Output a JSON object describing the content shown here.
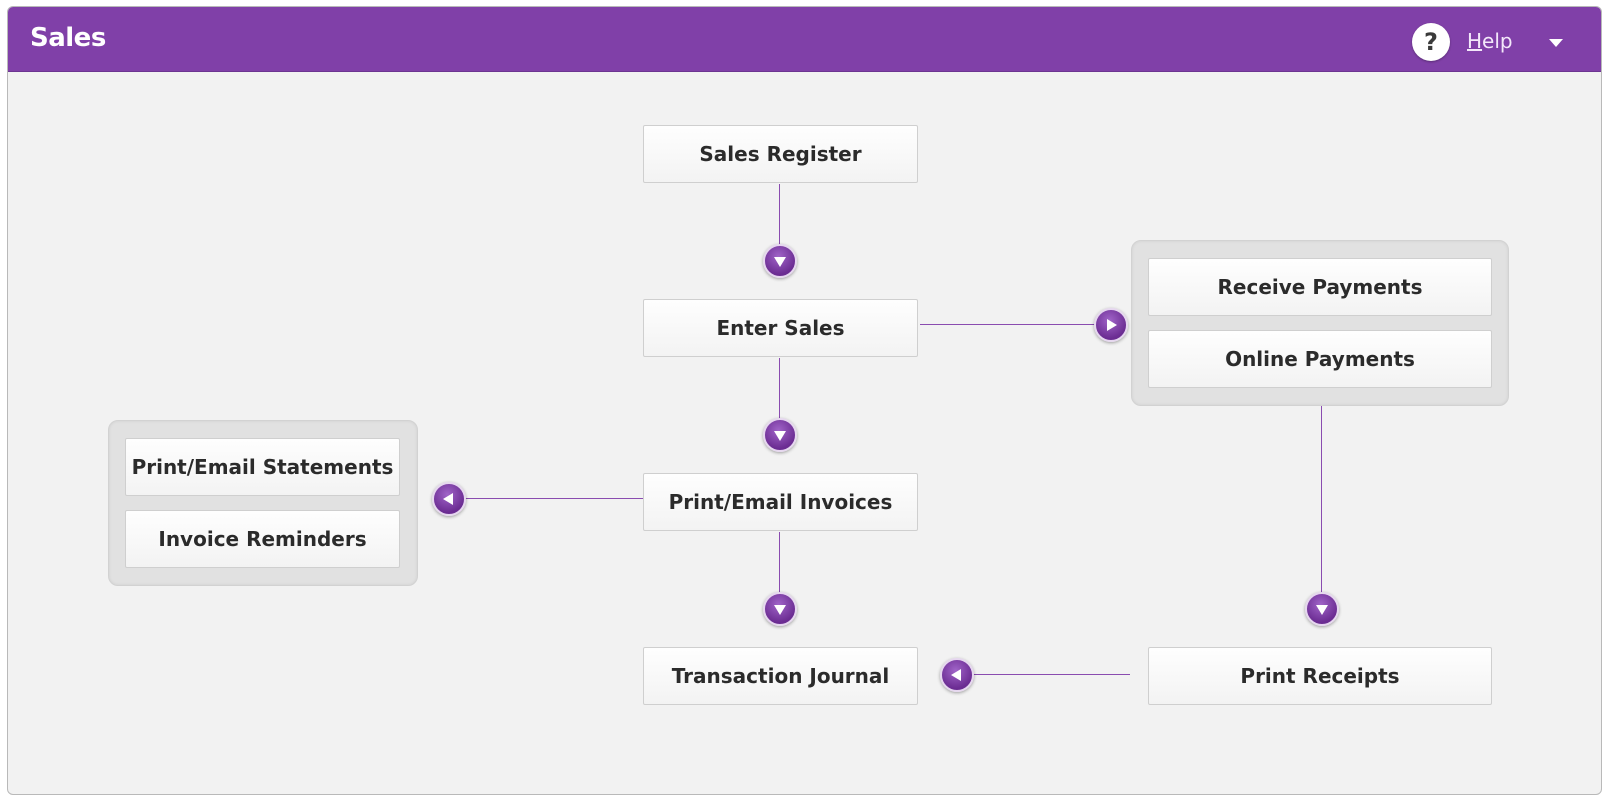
{
  "header": {
    "title": "Sales",
    "help_prefix": "H",
    "help_rest": "elp",
    "accent_color": "#8040a8"
  },
  "flow": {
    "sales_register": "Sales Register",
    "enter_sales": "Enter Sales",
    "receive_payments": "Receive Payments",
    "online_payments": "Online Payments",
    "print_email_invoices": "Print/Email Invoices",
    "print_email_statements": "Print/Email Statements",
    "invoice_reminders": "Invoice Reminders",
    "transaction_journal": "Transaction Journal",
    "print_receipts": "Print Receipts"
  },
  "icons": {
    "help": "question-icon",
    "dropdown": "chevron-down-icon",
    "arrow_down": "arrow-down-icon",
    "arrow_right": "arrow-right-icon",
    "arrow_left": "arrow-left-icon"
  }
}
